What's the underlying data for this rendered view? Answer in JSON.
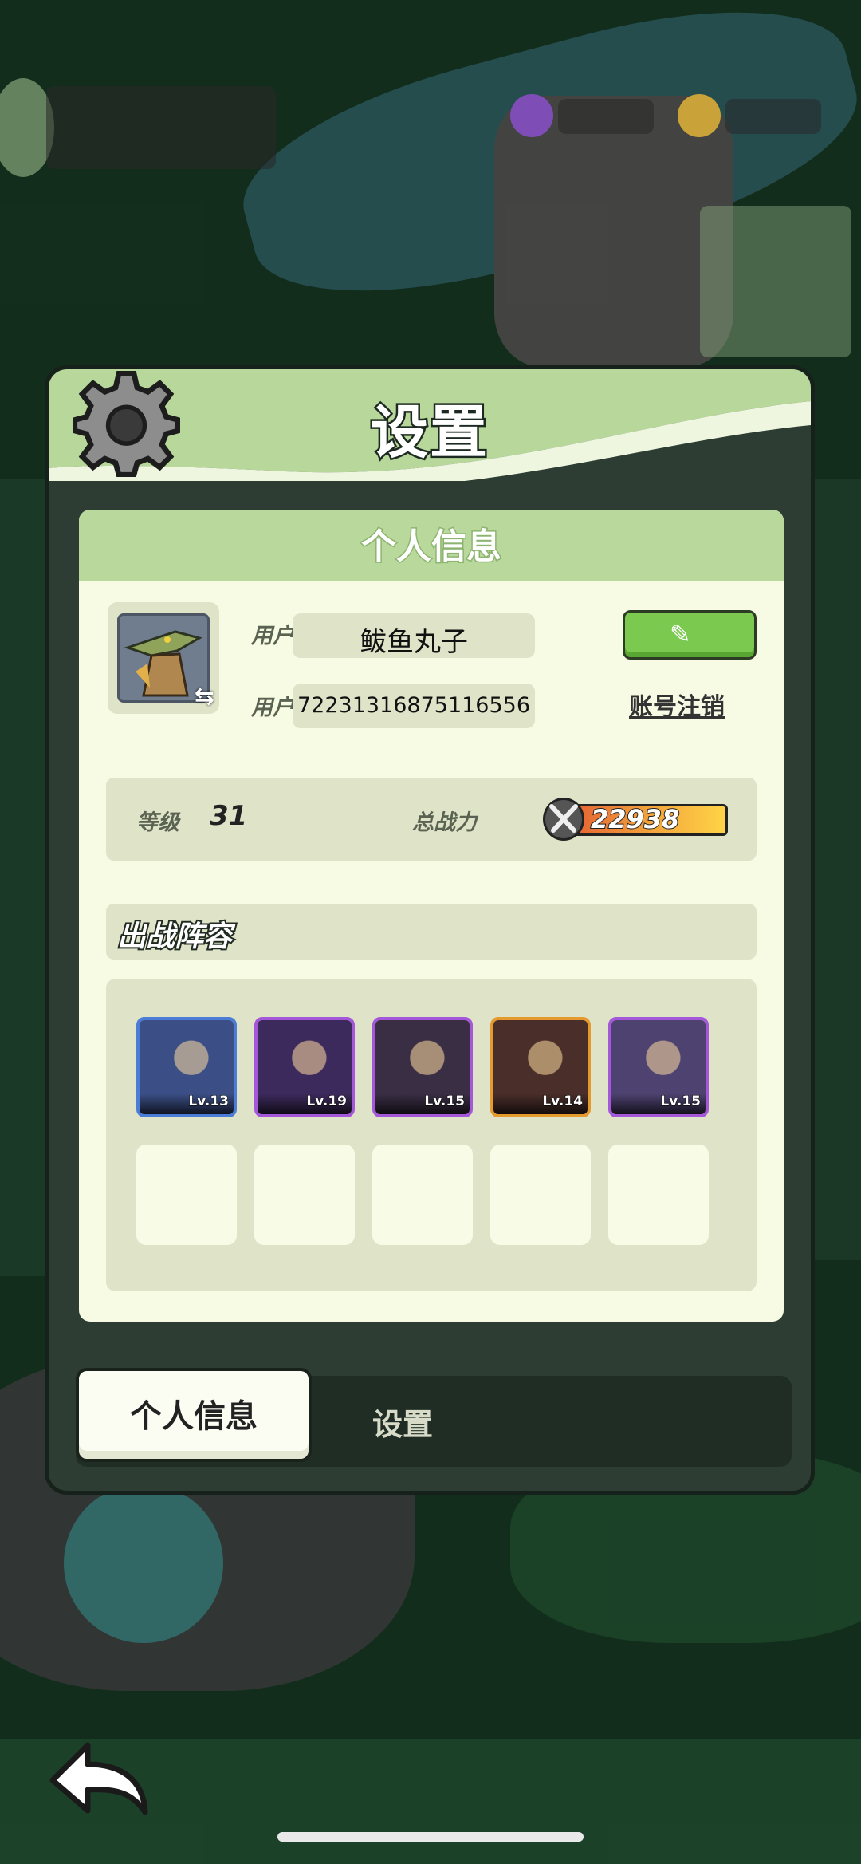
{
  "screen": {
    "title": "设置"
  },
  "profile_card": {
    "title": "个人信息",
    "nickname_label": "用户昵称",
    "nickname": "鲅鱼丸子",
    "user_id_label": "用户  ID",
    "user_id": "72231316875116556",
    "cancel_account": "账号注销",
    "level_label": "等级",
    "level": "31",
    "power_label": "总战力",
    "power": "22938"
  },
  "team": {
    "title": "出战阵容",
    "heroes": [
      {
        "level": "Lv.13",
        "frame": "#4b7dd6",
        "bg": "#3b4f86"
      },
      {
        "level": "Lv.19",
        "frame": "#a457d9",
        "bg": "#3d2a5c"
      },
      {
        "level": "Lv.15",
        "frame": "#a457d9",
        "bg": "#3a2e45"
      },
      {
        "level": "Lv.14",
        "frame": "#e59a2e",
        "bg": "#4a2e2a"
      },
      {
        "level": "Lv.15",
        "frame": "#a457d9",
        "bg": "#4e4270"
      }
    ]
  },
  "tabs": {
    "active": "个人信息",
    "other": "设置"
  }
}
